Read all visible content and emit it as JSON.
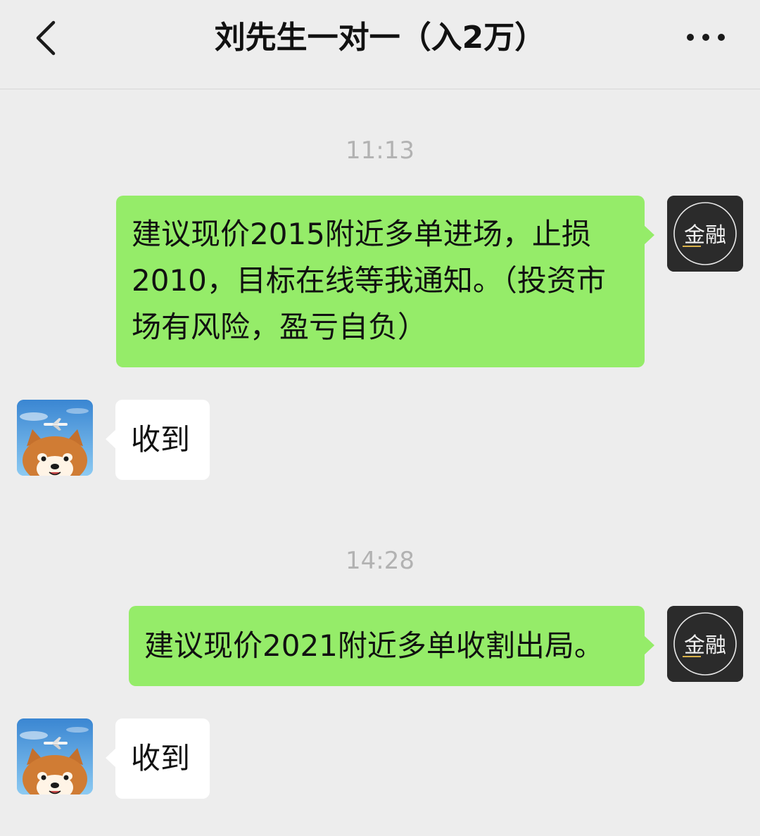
{
  "header": {
    "title": "刘先生一对一（入2万）",
    "back_icon": "chevron-left-icon",
    "more_icon": "more-dots-icon"
  },
  "messages": [
    {
      "timestamp": "11:13",
      "outgoing_text": "建议现价2015附近多单进场，止损2010，目标在线等我通知。（投资市场有风险，盈亏自负）",
      "reply_text": "收到"
    },
    {
      "timestamp": "14:28",
      "outgoing_text": "建议现价2021附近多单收割出局。",
      "reply_text": "收到"
    }
  ],
  "sender_avatar": {
    "logo_text": "金融",
    "background": "#2b2b2b"
  },
  "colors": {
    "outgoing_bubble": "#95ec69",
    "incoming_bubble": "#ffffff",
    "background": "#ededed",
    "timestamp": "#b2b2b2"
  }
}
